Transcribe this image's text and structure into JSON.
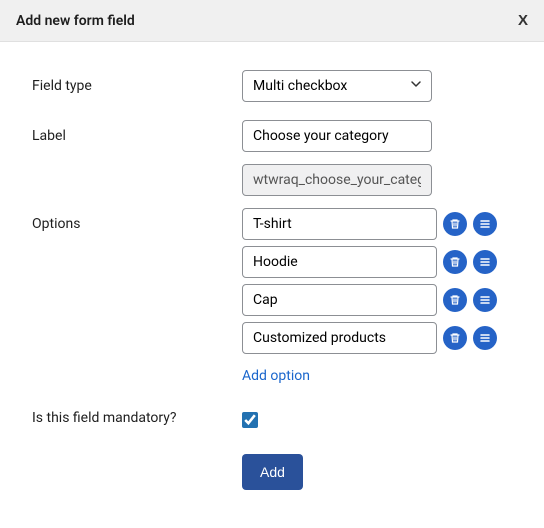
{
  "dialog": {
    "title": "Add new form field",
    "close": "X"
  },
  "fields": {
    "fieldType": {
      "label": "Field type",
      "value": "Multi checkbox"
    },
    "label": {
      "label": "Label",
      "value": "Choose your category",
      "slug": "wtwraq_choose_your_category"
    },
    "options": {
      "label": "Options",
      "items": [
        "T-shirt",
        "Hoodie",
        "Cap",
        "Customized products"
      ],
      "addLink": "Add option"
    },
    "mandatory": {
      "label": "Is this field mandatory?",
      "checked": true
    }
  },
  "submit": {
    "label": "Add"
  }
}
